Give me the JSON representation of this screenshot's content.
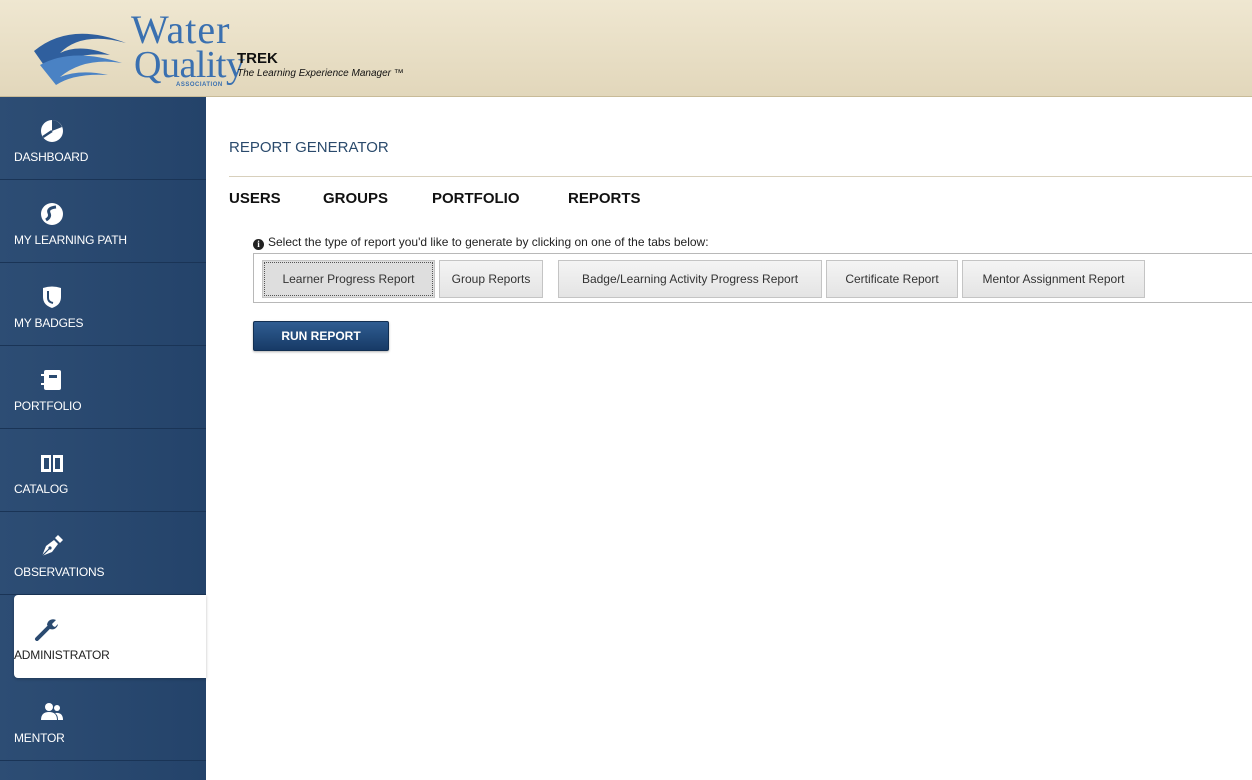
{
  "header": {
    "brand_line1": "Water",
    "brand_line2": "Quality",
    "brand_line3": "ASSOCIATION",
    "app_name": "TREK",
    "tagline": "The Learning Experience Manager ™"
  },
  "sidebar": {
    "items": [
      {
        "label": "DASHBOARD",
        "icon": "pie-chart-icon"
      },
      {
        "label": "MY LEARNING PATH",
        "icon": "path-swirl-icon"
      },
      {
        "label": "MY BADGES",
        "icon": "badge-shield-icon"
      },
      {
        "label": "PORTFOLIO",
        "icon": "notebook-icon"
      },
      {
        "label": "CATALOG",
        "icon": "open-book-icon"
      },
      {
        "label": "OBSERVATIONS",
        "icon": "pen-nib-icon"
      },
      {
        "label": "ADMINISTRATOR",
        "icon": "wrench-icon",
        "active": true
      },
      {
        "label": "MENTOR",
        "icon": "users-icon"
      }
    ]
  },
  "main": {
    "page_title": "REPORT GENERATOR",
    "top_tabs": [
      "USERS",
      "GROUPS",
      "PORTFOLIO",
      "REPORTS"
    ],
    "hint": "Select the type of report you'd like to generate by clicking on one of the tabs below:",
    "report_tabs": [
      "Learner Progress Report",
      "Group Reports",
      "Badge/Learning Activity Progress Report",
      "Certificate Report",
      "Mentor Assignment Report"
    ],
    "active_report_tab": "Learner Progress Report",
    "run_button": "RUN REPORT"
  },
  "colors": {
    "header_bg": "#e8dfc6",
    "sidebar_bg": "#2a4a70",
    "brand_blue": "#3a70b0",
    "button_bg": "#1f4a7a"
  }
}
